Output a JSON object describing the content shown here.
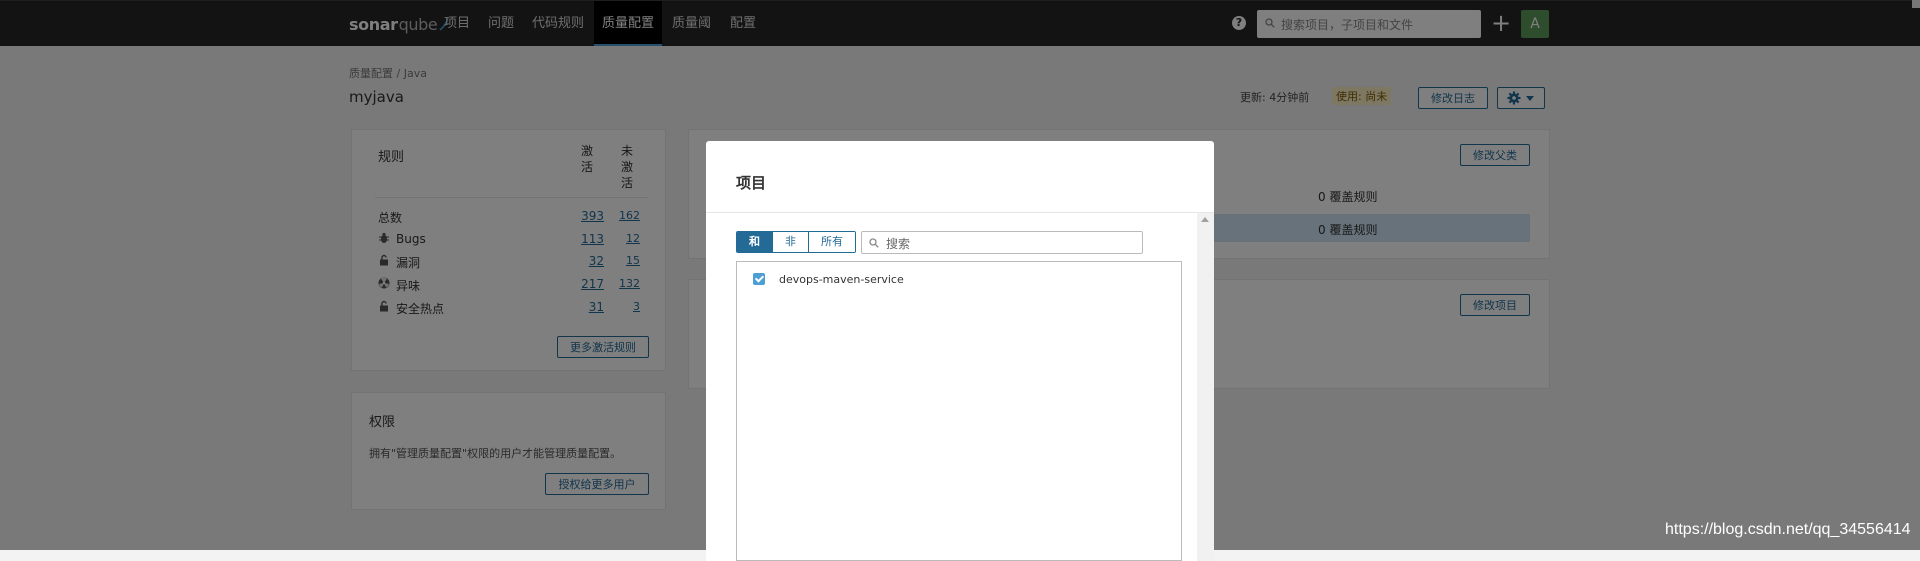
{
  "nav": {
    "logo_bold": "sonar",
    "logo_light": "qube",
    "items": [
      {
        "label": "项目"
      },
      {
        "label": "问题"
      },
      {
        "label": "代码规则"
      },
      {
        "label": "质量配置"
      },
      {
        "label": "质量阈"
      },
      {
        "label": "配置"
      }
    ],
    "active_index": 3,
    "help_glyph": "?",
    "search_placeholder": "搜索项目，子项目和文件",
    "plus_glyph": "+",
    "avatar_letter": "A"
  },
  "page": {
    "breadcrumb_parent": "质量配置",
    "breadcrumb_sep": " / ",
    "breadcrumb_current": "Java",
    "title": "myjava",
    "updated_label": "更新: 4分钟前",
    "used_label": "使用: 尚未",
    "changelog_button": "修改日志"
  },
  "rules": {
    "header": "规则",
    "active_header": "激活",
    "inactive_header": "未激活",
    "rows": [
      {
        "label": "总数",
        "icon": "",
        "active": "393",
        "inactive": "162"
      },
      {
        "label": "Bugs",
        "icon": "bug-icon",
        "active": "113",
        "inactive": "12"
      },
      {
        "label": "漏洞",
        "icon": "lock-icon",
        "active": "32",
        "inactive": "15"
      },
      {
        "label": "异味",
        "icon": "code-smell-icon",
        "active": "217",
        "inactive": "132"
      },
      {
        "label": "安全热点",
        "icon": "hotspot-icon",
        "active": "31",
        "inactive": "3"
      }
    ],
    "more_button": "更多激活规则"
  },
  "permissions": {
    "title": "权限",
    "text": "拥有\"管理质量配置\"权限的用户才能管理质量配置。",
    "grant_button": "授权给更多用户"
  },
  "inheritance": {
    "change_parent_button": "修改父类",
    "row1": "0 覆盖规则",
    "row2": "0 覆盖规则"
  },
  "projects_card": {
    "change_projects_button": "修改项目"
  },
  "modal": {
    "title": "项目",
    "filters": [
      {
        "label": "和"
      },
      {
        "label": "非"
      },
      {
        "label": "所有"
      }
    ],
    "selected_filter_index": 0,
    "search_placeholder": "搜索",
    "items": [
      {
        "name": "devops-maven-service",
        "checked": true
      }
    ]
  },
  "watermark": "https://blog.csdn.net/qq_34556414",
  "colors": {
    "nav_bg": "#262626",
    "accent": "#236a97",
    "highlight_row": "#cfe5f4",
    "used_badge": "#fdf1c6"
  }
}
